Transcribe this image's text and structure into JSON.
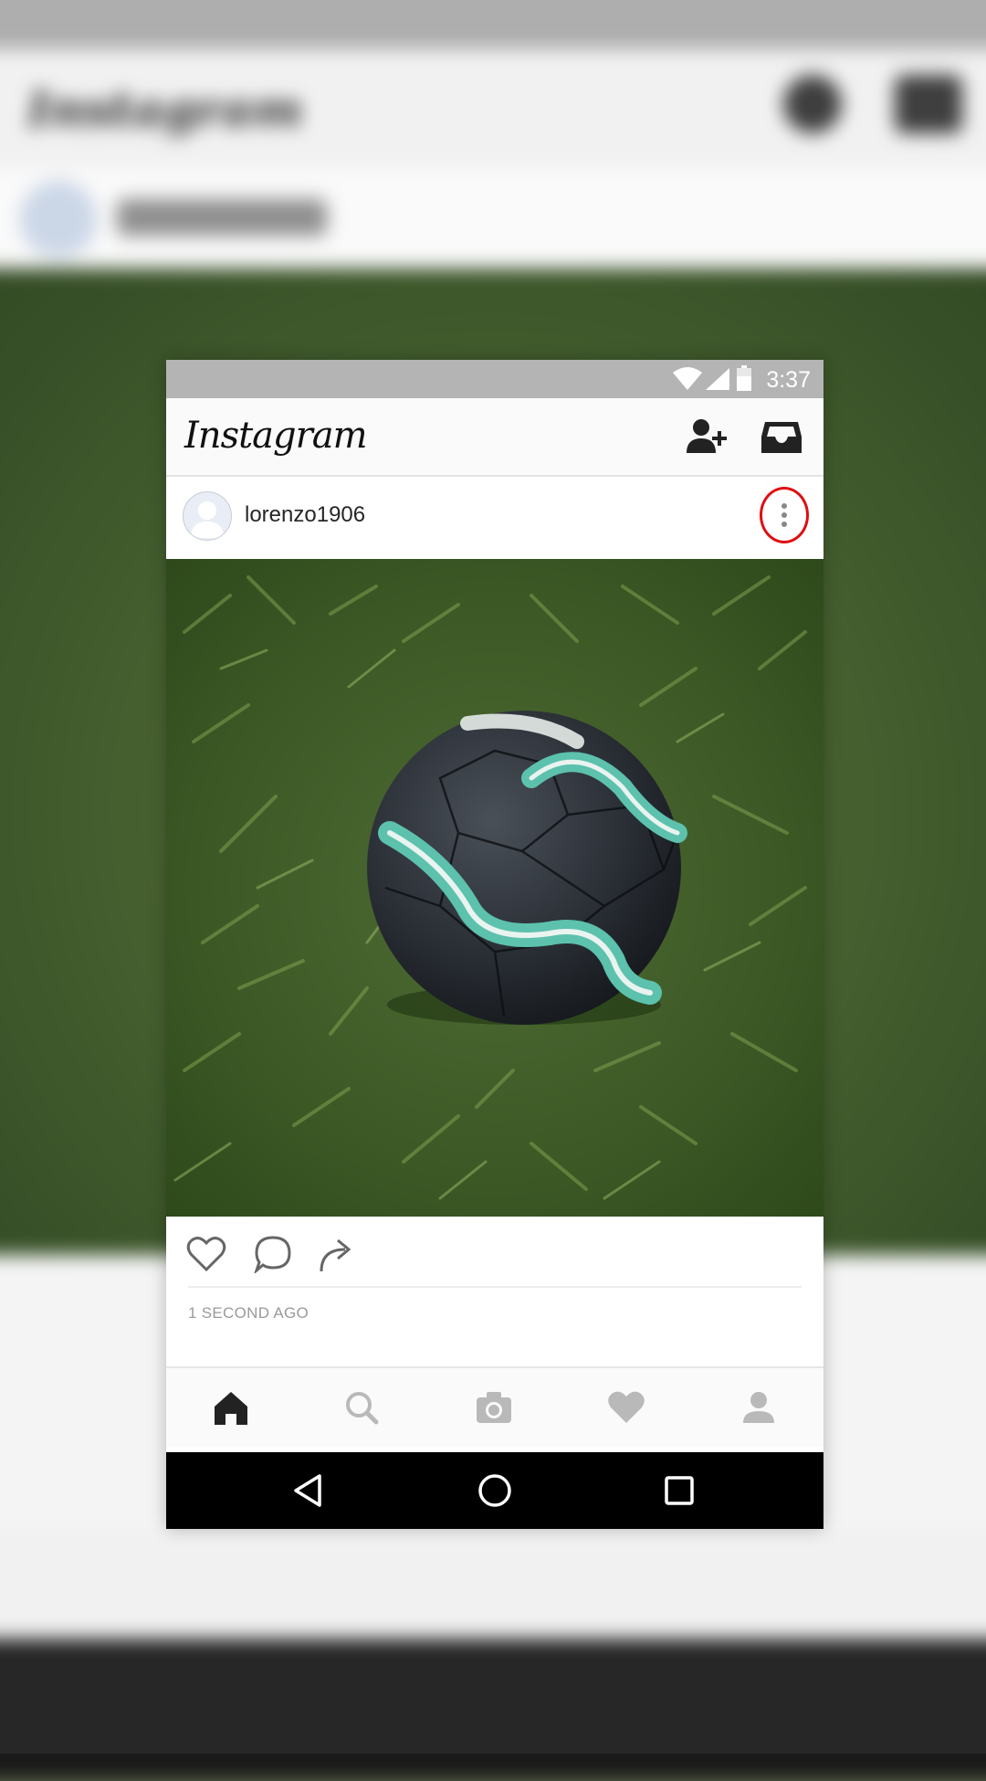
{
  "status_bar": {
    "time": "3:37"
  },
  "toolbar": {
    "app_title": "Instagram"
  },
  "post": {
    "username": "lorenzo1906",
    "timestamp": "1 SECOND AGO"
  },
  "icons": {
    "toolbar": [
      "add-user-icon",
      "inbox-icon"
    ],
    "post_header": [
      "more-options-icon"
    ],
    "post_actions": [
      "like-heart-icon",
      "comment-icon",
      "share-icon"
    ],
    "tab_bar": [
      "home-icon",
      "search-icon",
      "camera-icon",
      "activity-heart-icon",
      "profile-icon"
    ],
    "system_nav": [
      "back-icon",
      "home-circle-icon",
      "recents-icon"
    ]
  },
  "colors": {
    "highlight_ring": "#e00d12",
    "status_bar": "#b4b4b4",
    "system_nav": "#000000"
  }
}
